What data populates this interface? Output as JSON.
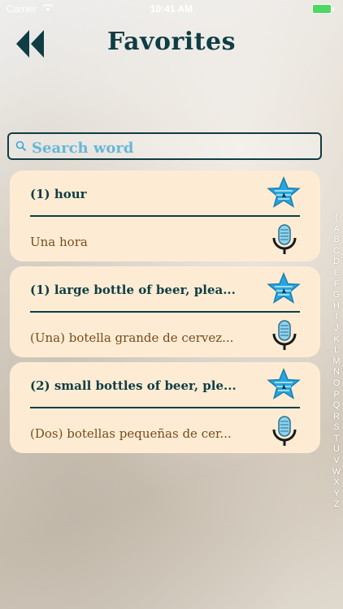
{
  "status_bar": {
    "carrier": "Carrier",
    "time": "10:41 AM"
  },
  "header": {
    "title": "Favorites",
    "back_icon": "double-chevron-left-icon"
  },
  "search": {
    "placeholder": "Search word",
    "value": ""
  },
  "favorites": [
    {
      "english": "(1) hour",
      "spanish": "Una hora",
      "favorite_icon": "star-icon",
      "audio_icon": "microphone-icon"
    },
    {
      "english": "(1) large bottle of beer, plea...",
      "spanish": "(Una) botella grande de cervez...",
      "favorite_icon": "star-icon",
      "audio_icon": "microphone-icon"
    },
    {
      "english": "(2) small bottles of beer, ple...",
      "spanish": "(Dos) botellas pequeñas de cer...",
      "favorite_icon": "star-icon",
      "audio_icon": "microphone-icon"
    }
  ],
  "alphabet_index": [
    "(",
    "A",
    "B",
    "C",
    "D",
    "E",
    "F",
    "G",
    "H",
    "I",
    "J",
    "K",
    "L",
    "M",
    "N",
    "O",
    "P",
    "Q",
    "R",
    "S",
    "T",
    "U",
    "V",
    "W",
    "X",
    "Y",
    "Z"
  ],
  "colors": {
    "accent_dark": "#0f3d44",
    "card_background": "#fdecd3",
    "spanish_text": "#7a4a1a",
    "star_blue": "#2aa4dc",
    "battery_green": "#4cd964"
  }
}
